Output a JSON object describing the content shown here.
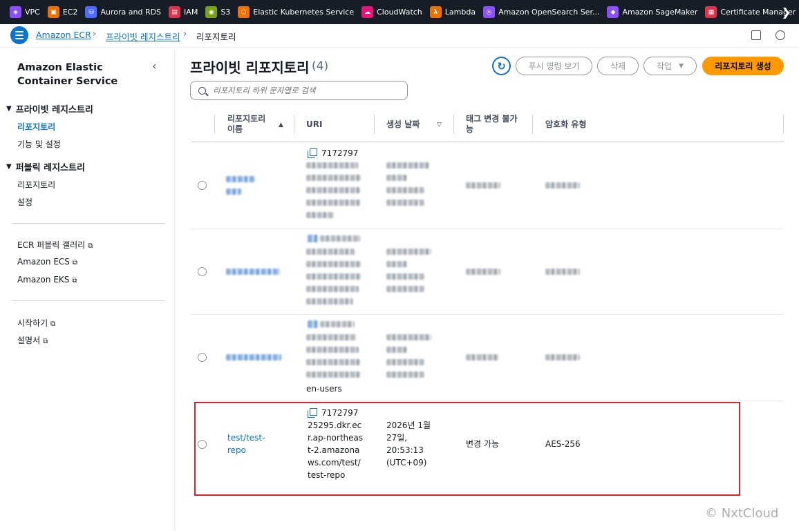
{
  "topbar": {
    "services": [
      {
        "label": "VPC",
        "color": "#8c4fff"
      },
      {
        "label": "EC2",
        "color": "#ed7100"
      },
      {
        "label": "Aurora and RDS",
        "color": "#4d6bfe"
      },
      {
        "label": "IAM",
        "color": "#dd344c"
      },
      {
        "label": "S3",
        "color": "#7aa116"
      },
      {
        "label": "Elastic Kubernetes Service",
        "color": "#ed7100"
      },
      {
        "label": "CloudWatch",
        "color": "#e7157b"
      },
      {
        "label": "Lambda",
        "color": "#ed7100"
      },
      {
        "label": "Amazon OpenSearch Ser...",
        "color": "#8c4fff"
      },
      {
        "label": "Amazon SageMaker",
        "color": "#8c4fff"
      },
      {
        "label": "Certificate Manager",
        "color": "#dd344c"
      }
    ]
  },
  "breadcrumb": {
    "items": [
      "Amazon ECR",
      "프라이빗 레지스트리",
      "리포지토리"
    ]
  },
  "sidenav": {
    "title": "Amazon Elastic Container Service",
    "private_registry": "프라이빗 레지스트리",
    "private_items": [
      "리포지토리",
      "기능 및 설정"
    ],
    "public_registry": "퍼블릭 레지스트리",
    "public_items": [
      "리포지토리",
      "설정"
    ],
    "links": [
      "ECR 퍼블릭 갤러리",
      "Amazon ECS",
      "Amazon EKS"
    ],
    "help_links": [
      "시작하기",
      "설명서"
    ]
  },
  "header": {
    "title": "프라이빗 리포지토리",
    "count": "(4)",
    "buttons": {
      "push": "푸시 명령 보기",
      "delete": "삭제",
      "actions": "작업",
      "create": "리포지토리 생성"
    },
    "search_placeholder": "리포지토리 하위 문자열로 검색"
  },
  "table": {
    "columns": [
      "리포지토리 이름",
      "URI",
      "생성 날짜",
      "태그 변경 불가능",
      "암호화 유형"
    ],
    "rows": [
      {
        "uri_prefix": "7172797",
        "uri_tail": ""
      },
      {
        "uri_prefix": "",
        "uri_tail": ""
      },
      {
        "uri_prefix": "",
        "uri_tail": "en-users"
      },
      {
        "name_line1": "test/test-",
        "name_line2": "repo",
        "uri_lines": [
          "7172797",
          "25295.dkr.ec",
          "r.ap-northeas",
          "t-2.amazona",
          "ws.com/test/",
          "test-repo"
        ],
        "date_lines": [
          "2026년 1월",
          "27일,",
          "20:53:13",
          "(UTC+09)"
        ],
        "mutability": "변경 가능",
        "encryption": "AES-256"
      }
    ]
  },
  "watermark": "© NxtCloud"
}
